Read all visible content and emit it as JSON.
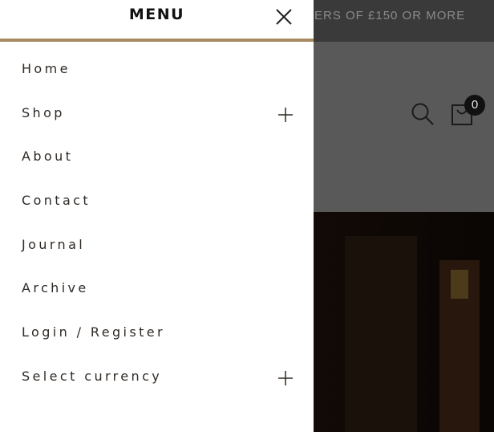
{
  "background": {
    "announcement": "ERS OF £150 OR MORE",
    "cart_count": "0"
  },
  "drawer": {
    "title": "MENU",
    "items": [
      {
        "label": "Home",
        "expandable": false
      },
      {
        "label": "Shop",
        "expandable": true
      },
      {
        "label": "About",
        "expandable": false
      },
      {
        "label": "Contact",
        "expandable": false
      },
      {
        "label": "Journal",
        "expandable": false
      },
      {
        "label": "Archive",
        "expandable": false
      },
      {
        "label": "Login / Register",
        "expandable": false
      },
      {
        "label": "Select currency",
        "expandable": true
      }
    ]
  },
  "colors": {
    "accent": "#a88a63",
    "text": "#2f2924",
    "overlay": "#595959"
  },
  "icons": [
    "close-icon",
    "plus-icon",
    "search-icon",
    "shopping-bag-icon"
  ]
}
